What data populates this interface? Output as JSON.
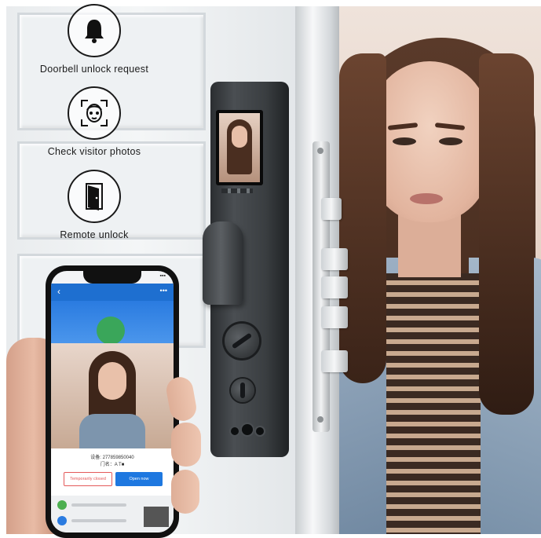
{
  "features": [
    {
      "label": "Doorbell unlock request",
      "icon": "bell-icon"
    },
    {
      "label": "Check visitor photos",
      "icon": "face-scan-icon"
    },
    {
      "label": "Remote unlock",
      "icon": "door-icon"
    }
  ],
  "phone": {
    "device_id": "设备: 277859850040",
    "visitor_name": "门名：A T■",
    "deny_label": "Temporarily closed",
    "open_label": "Open now"
  },
  "colors": {
    "app_blue": "#1e6fd0",
    "open_button": "#1e78e0",
    "deny_button": "#e45a5a"
  }
}
